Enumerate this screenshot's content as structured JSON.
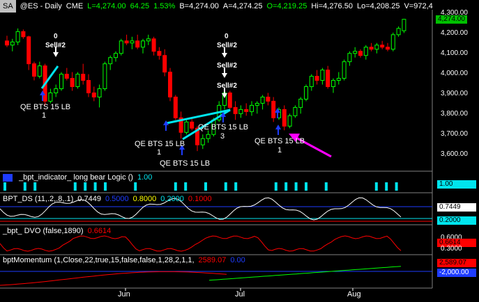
{
  "header": {
    "badge": "SA",
    "symbol": "@ES - Daily",
    "exchange": "CME",
    "last": "L=4,274.00",
    "change": "64.25",
    "change_pct": "1.53%",
    "bid": "B=4,274.00",
    "ask": "A=4,274.25",
    "open": "O=4,219.25",
    "high": "Hi=4,276.50",
    "low": "Lo=4,208.25",
    "volume": "V=972,4"
  },
  "price_axis": {
    "ticks": [
      "4,300.00",
      "4,200.00",
      "4,100.00",
      "4,000.00",
      "3,900.00",
      "3,800.00",
      "3,700.00",
      "3,600.00"
    ],
    "last_label": "4,274.00"
  },
  "x_axis": {
    "ticks": [
      "Jun",
      "Jul",
      "Aug"
    ]
  },
  "annotations": {
    "sell_1_count": "0",
    "sell_1": "Sell#2",
    "sell_2_count": "0",
    "sell_2a": "Sell#2",
    "sell_2b": "Sell#2",
    "sell_2c": "Sell#2",
    "qe_1": "QE BTS 15 LB",
    "qe_1_n": "1",
    "qe_2": "QE BTS 15 LB",
    "qe_2_n": "3",
    "qe_3": "QE BTS 15 LB",
    "qe_3_n": "1",
    "qe_4": "QE BTS 15 LB",
    "qe_5": "QE BTS 15 LB",
    "qe_5_n": "1"
  },
  "panes": {
    "indicator": {
      "label": "_bpt_indicator_ long bear Logic ()",
      "value": "1.00",
      "axis": "1.00"
    },
    "ds": {
      "label": "BPT_DS (11,.2,.8,.1)",
      "v1": "0.7449",
      "v2": "0.5000",
      "v3": "0.8000",
      "v4": "0.2000",
      "v5": "0.1000",
      "axis_top": "0.7449",
      "axis_bot": "0.2000"
    },
    "dvo": {
      "label": "_bpt_ DVO (false,1890)",
      "value": "0.6614",
      "axis_top": "0.6000",
      "axis_mid": "0.6614",
      "axis_bot": "0.3000"
    },
    "momentum": {
      "label": "bptMomentum (1,Close,22,true,15,false,false,1,28,2,1,1,",
      "value": "2589.07",
      "value2": "0.00",
      "axis_top": "2,589.07",
      "axis_bot": "-2,000.00"
    }
  },
  "colors": {
    "up": "#00ff00",
    "down": "#ff0000",
    "cyan": "#00e5ee",
    "magenta": "#ff00ff",
    "blue": "#1e3cff",
    "yellow": "#ffff00",
    "axis_green": "#00c000"
  },
  "chart_data": {
    "type": "candlestick",
    "title": "@ES - Daily",
    "ylim": [
      3550,
      4320
    ],
    "ohlc": [
      [
        4170,
        4195,
        4140,
        4150
      ],
      [
        4150,
        4180,
        4120,
        4165
      ],
      [
        4165,
        4230,
        4150,
        4215
      ],
      [
        4215,
        4225,
        4180,
        4190
      ],
      [
        4190,
        4195,
        4030,
        4060
      ],
      [
        4060,
        4070,
        3980,
        4000
      ],
      [
        4000,
        4070,
        3990,
        4050
      ],
      [
        4050,
        4060,
        3860,
        3880
      ],
      [
        3880,
        3940,
        3870,
        3920
      ],
      [
        3920,
        3960,
        3900,
        3940
      ],
      [
        3940,
        4020,
        3930,
        4010
      ],
      [
        4010,
        4040,
        3980,
        3990
      ],
      [
        3990,
        4020,
        3930,
        3950
      ],
      [
        3950,
        4020,
        3940,
        4010
      ],
      [
        4010,
        4060,
        3960,
        3980
      ],
      [
        3980,
        4010,
        3900,
        3920
      ],
      [
        3920,
        3950,
        3880,
        3900
      ],
      [
        3900,
        3960,
        3850,
        3940
      ],
      [
        3940,
        4070,
        3930,
        4060
      ],
      [
        4060,
        4100,
        4030,
        4090
      ],
      [
        4090,
        4120,
        4070,
        4110
      ],
      [
        4110,
        4180,
        4100,
        4170
      ],
      [
        4170,
        4200,
        4150,
        4160
      ],
      [
        4160,
        4190,
        4130,
        4170
      ],
      [
        4170,
        4200,
        4130,
        4140
      ],
      [
        4140,
        4180,
        4110,
        4170
      ],
      [
        4170,
        4200,
        4150,
        4180
      ],
      [
        4180,
        4190,
        4100,
        4120
      ],
      [
        4120,
        4140,
        4080,
        4100
      ],
      [
        4100,
        4130,
        4000,
        4020
      ],
      [
        4020,
        4040,
        3880,
        3900
      ],
      [
        3900,
        3910,
        3790,
        3800
      ],
      [
        3800,
        3830,
        3700,
        3730
      ],
      [
        3730,
        3790,
        3720,
        3780
      ],
      [
        3780,
        3800,
        3740,
        3750
      ],
      [
        3750,
        3760,
        3640,
        3670
      ],
      [
        3670,
        3720,
        3650,
        3700
      ],
      [
        3700,
        3740,
        3680,
        3720
      ],
      [
        3720,
        3800,
        3710,
        3790
      ],
      [
        3790,
        3880,
        3780,
        3860
      ],
      [
        3860,
        3930,
        3840,
        3920
      ],
      [
        3920,
        3930,
        3830,
        3850
      ],
      [
        3850,
        3880,
        3790,
        3820
      ],
      [
        3820,
        3860,
        3800,
        3840
      ],
      [
        3840,
        3870,
        3810,
        3830
      ],
      [
        3830,
        3880,
        3810,
        3860
      ],
      [
        3860,
        3880,
        3820,
        3870
      ],
      [
        3870,
        3910,
        3840,
        3900
      ],
      [
        3900,
        3920,
        3860,
        3880
      ],
      [
        3880,
        3900,
        3780,
        3800
      ],
      [
        3800,
        3850,
        3790,
        3840
      ],
      [
        3840,
        3860,
        3740,
        3760
      ],
      [
        3760,
        3820,
        3750,
        3810
      ],
      [
        3810,
        3860,
        3800,
        3850
      ],
      [
        3850,
        3900,
        3820,
        3890
      ],
      [
        3890,
        3960,
        3880,
        3950
      ],
      [
        3950,
        4010,
        3930,
        4000
      ],
      [
        4000,
        4030,
        3960,
        3980
      ],
      [
        3980,
        4040,
        3960,
        4030
      ],
      [
        4030,
        4050,
        3940,
        3950
      ],
      [
        3950,
        3990,
        3920,
        3980
      ],
      [
        3980,
        4020,
        3960,
        3990
      ],
      [
        3990,
        4080,
        3980,
        4070
      ],
      [
        4070,
        4120,
        4050,
        4110
      ],
      [
        4110,
        4140,
        4090,
        4120
      ],
      [
        4120,
        4130,
        4090,
        4100
      ],
      [
        4100,
        4150,
        4080,
        4140
      ],
      [
        4140,
        4160,
        4120,
        4130
      ],
      [
        4130,
        4160,
        4110,
        4150
      ],
      [
        4150,
        4170,
        4130,
        4140
      ],
      [
        4140,
        4160,
        4120,
        4130
      ],
      [
        4130,
        4210,
        4120,
        4200
      ],
      [
        4200,
        4240,
        4190,
        4230
      ],
      [
        4219,
        4276,
        4208,
        4274
      ]
    ],
    "xlabels": [
      "Jun",
      "Jul",
      "Aug"
    ]
  }
}
